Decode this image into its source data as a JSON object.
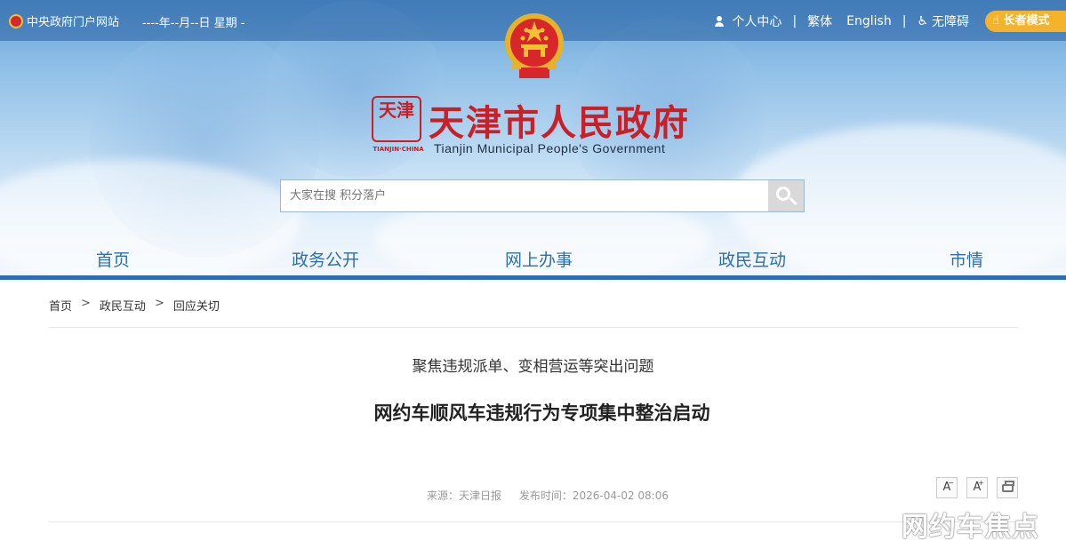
{
  "topbar": {
    "portal_link": "中央政府门户网站",
    "date_text": "----年--月--日 星期 -",
    "user_center": "个人中心",
    "traditional": "繁体",
    "english": "English",
    "accessibility": "无障碍",
    "elder_mode": "长者模式",
    "separator": "|"
  },
  "logo": {
    "seal_text": "天津",
    "seal_sub": "TIANJIN·CHINA",
    "title_cn": "天津市人民政府",
    "title_en": "Tianjin Municipal People's Government"
  },
  "search": {
    "placeholder": "大家在搜 积分落户"
  },
  "nav": {
    "items": [
      {
        "label": "首页"
      },
      {
        "label": "政务公开"
      },
      {
        "label": "网上办事"
      },
      {
        "label": "政民互动"
      },
      {
        "label": "市情"
      }
    ]
  },
  "breadcrumb": {
    "items": [
      "首页",
      "政民互动",
      "回应关切"
    ],
    "arrow": ">"
  },
  "article": {
    "subtitle": "聚焦违规派单、变相营运等突出问题",
    "title": "网约车顺风车违规行为专项集中整治启动",
    "source": "来源：天津日报",
    "publish_time": "发布时间：2026-04-02 08:06"
  },
  "tools": {
    "decrease": "A",
    "increase": "A",
    "minus": "−",
    "plus": "+"
  },
  "watermark": "网约车焦点",
  "colors": {
    "nav_blue": "#2a6fb0",
    "bar_blue": "#2d6db3",
    "logo_red": "#c91f26",
    "elder_orange": "#f5b32b"
  }
}
